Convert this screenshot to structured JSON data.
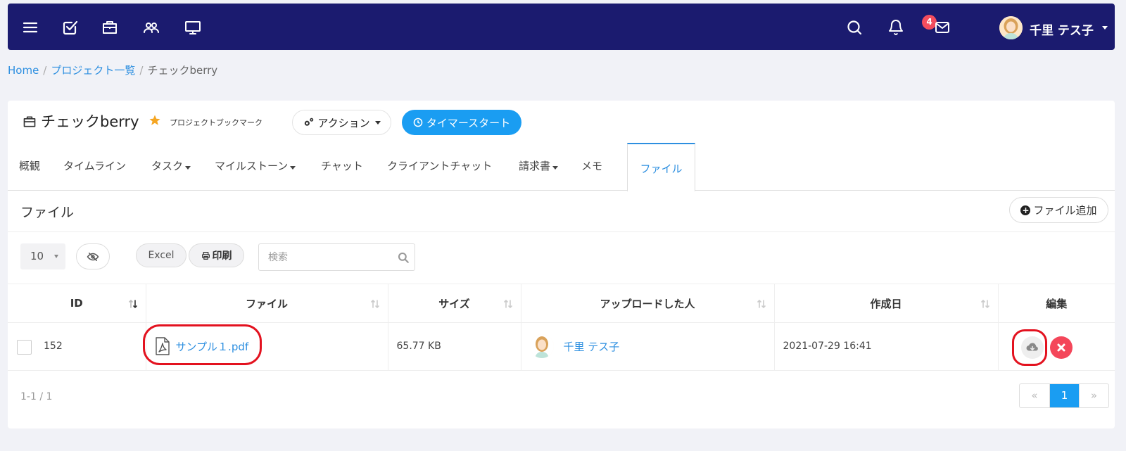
{
  "topbar": {
    "icons": [
      "menu-icon",
      "checkbox-icon",
      "briefcase-icon",
      "users-icon",
      "monitor-icon",
      "search-icon",
      "bell-icon",
      "mail-icon"
    ],
    "notification_count": "4",
    "user_name": "千里 テス子"
  },
  "breadcrumb": {
    "home": "Home",
    "projects": "プロジェクト一覧",
    "current": "チェックberry"
  },
  "project": {
    "title": "チェックberry",
    "bookmark_label": "プロジェクトブックマーク",
    "action_label": "アクション",
    "timer_label": "タイマースタート"
  },
  "tabs": {
    "overview": "概観",
    "timeline": "タイムライン",
    "tasks": "タスク",
    "milestones": "マイルストーン",
    "chat": "チャット",
    "client_chat": "クライアントチャット",
    "invoice": "請求書",
    "memo": "メモ",
    "files": "ファイル"
  },
  "files": {
    "section_title": "ファイル",
    "add_label": "ファイル追加",
    "page_size": "10",
    "excel_label": "Excel",
    "print_label": "印刷",
    "search_placeholder": "検索",
    "columns": {
      "id": "ID",
      "file": "ファイル",
      "size": "サイズ",
      "uploader": "アップロードした人",
      "created": "作成日",
      "edit": "編集"
    },
    "rows": [
      {
        "id": "152",
        "file": "サンプル１.pdf",
        "size": "65.77 KB",
        "uploader": "千里 テス子",
        "created": "2021-07-29 16:41"
      }
    ],
    "range_info": "1-1 / 1",
    "pagination": {
      "prev": "«",
      "current": "1",
      "next": "»"
    }
  },
  "colors": {
    "topbar": "#1b1b6f",
    "accent": "#1a9df2",
    "link": "#2d8fe0",
    "danger": "#f4465a",
    "highlight": "#e3121f",
    "star": "#f5a623"
  }
}
